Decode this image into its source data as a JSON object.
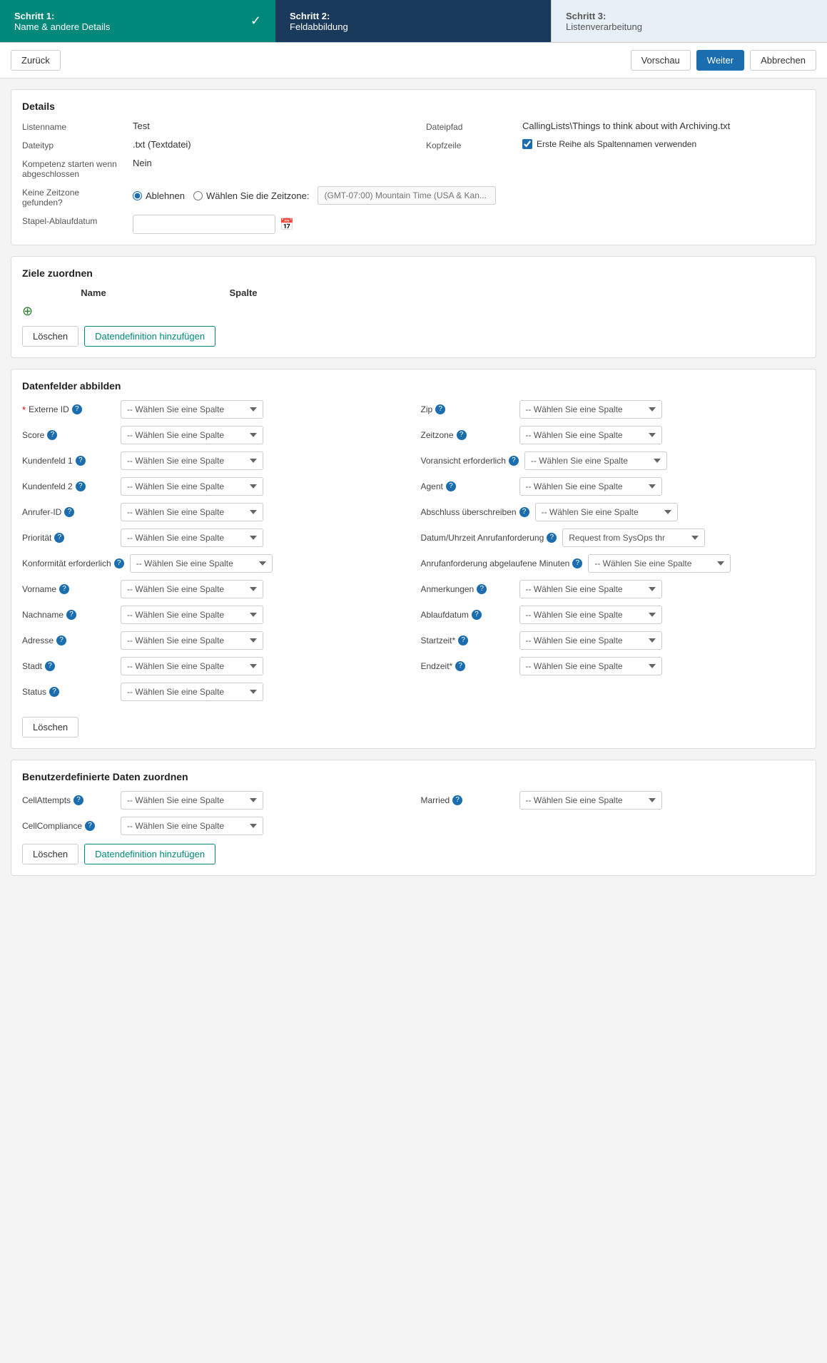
{
  "steps": [
    {
      "id": "step1",
      "number": "Schritt 1:",
      "title": "Name & andere Details",
      "completed": true,
      "active": false
    },
    {
      "id": "step2",
      "number": "Schritt 2:",
      "title": "Feldabbildung",
      "completed": false,
      "active": true
    },
    {
      "id": "step3",
      "number": "Schritt 3:",
      "title": "Listenverarbeitung",
      "completed": false,
      "active": false
    }
  ],
  "toolbar": {
    "back_label": "Zurück",
    "preview_label": "Vorschau",
    "next_label": "Weiter",
    "cancel_label": "Abbrechen"
  },
  "details": {
    "section_title": "Details",
    "listenname_label": "Listenname",
    "listenname_value": "Test",
    "dateipfad_label": "Dateipfad",
    "dateipfad_value": "CallingLists\\Things to think about with Archiving.txt",
    "dateityp_label": "Dateityp",
    "dateityp_value": ".txt (Textdatei)",
    "kopfzeile_label": "Kopfzeile",
    "kopfzeile_checkbox_label": "Erste Reihe als Spaltennamen verwenden",
    "kompetenz_label": "Kompetenz starten wenn abgeschlossen",
    "kompetenz_value": "Nein",
    "keine_zeitzone_label": "Keine Zeitzone gefunden?",
    "radio_ablehnen": "Ablehnen",
    "radio_waehlen": "Wählen Sie die Zeitzone:",
    "timezone_placeholder": "(GMT-07:00) Mountain Time (USA & Kan...",
    "stapel_label": "Stapel-Ablaufdatum"
  },
  "ziele": {
    "section_title": "Ziele zuordnen",
    "col_name": "Name",
    "col_spalte": "Spalte",
    "delete_label": "Löschen",
    "add_label": "Datendefinition hinzufügen"
  },
  "datenfelder": {
    "section_title": "Datenfelder abbilden",
    "fields_left": [
      {
        "id": "externe-id",
        "label": "Externe ID",
        "required": true,
        "info": true
      },
      {
        "id": "score",
        "label": "Score",
        "required": false,
        "info": true
      },
      {
        "id": "kundenfeld1",
        "label": "Kundenfeld 1",
        "required": false,
        "info": true
      },
      {
        "id": "kundenfeld2",
        "label": "Kundenfeld 2",
        "required": false,
        "info": true
      },
      {
        "id": "anrufer-id",
        "label": "Anrufer-ID",
        "required": false,
        "info": true
      },
      {
        "id": "prioritaet",
        "label": "Priorität",
        "required": false,
        "info": true
      },
      {
        "id": "konformitaet",
        "label": "Konformität erforderlich",
        "required": false,
        "info": true
      },
      {
        "id": "vorname",
        "label": "Vorname",
        "required": false,
        "info": true
      },
      {
        "id": "nachname",
        "label": "Nachname",
        "required": false,
        "info": true
      },
      {
        "id": "adresse",
        "label": "Adresse",
        "required": false,
        "info": true
      },
      {
        "id": "stadt",
        "label": "Stadt",
        "required": false,
        "info": true
      },
      {
        "id": "status",
        "label": "Status",
        "required": false,
        "info": true
      }
    ],
    "fields_right": [
      {
        "id": "zip",
        "label": "Zip",
        "required": false,
        "info": true
      },
      {
        "id": "zeitzone",
        "label": "Zeitzone",
        "required": false,
        "info": true
      },
      {
        "id": "voransicht",
        "label": "Voransicht erforderlich",
        "required": false,
        "info": true
      },
      {
        "id": "agent",
        "label": "Agent",
        "required": false,
        "info": true
      },
      {
        "id": "abschluss",
        "label": "Abschluss überschreiben",
        "required": false,
        "info": true
      },
      {
        "id": "datum-uhrzeit",
        "label": "Datum/Uhrzeit Anrufanforderung",
        "required": false,
        "info": true,
        "value": "Request from SysOps thr"
      },
      {
        "id": "anrufanforderung",
        "label": "Anrufanforderung abgelaufene Minuten",
        "required": false,
        "info": true
      },
      {
        "id": "anmerkungen",
        "label": "Anmerkungen",
        "required": false,
        "info": true
      },
      {
        "id": "ablaufdatum",
        "label": "Ablaufdatum",
        "required": false,
        "info": true
      },
      {
        "id": "startzeit",
        "label": "Startzeit*",
        "required": false,
        "info": true
      },
      {
        "id": "endzeit",
        "label": "Endzeit*",
        "required": false,
        "info": true
      }
    ],
    "placeholder": "-- Wählen Sie eine Spalte",
    "delete_label": "Löschen"
  },
  "benutzerdefiniert": {
    "section_title": "Benutzerdefinierte Daten zuordnen",
    "fields": [
      {
        "id": "cell-attempts",
        "label": "CellAttempts",
        "info": true,
        "col": "left"
      },
      {
        "id": "married",
        "label": "Married",
        "info": true,
        "col": "right"
      },
      {
        "id": "cell-compliance",
        "label": "CellCompliance",
        "info": true,
        "col": "left"
      }
    ],
    "placeholder": "-- Wählen Sie eine Spalte",
    "delete_label": "Löschen",
    "add_label": "Datendefinition hinzufügen"
  }
}
